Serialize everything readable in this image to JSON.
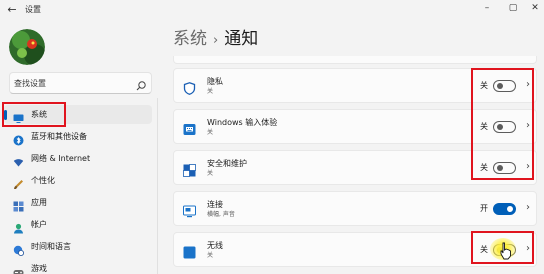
{
  "window": {
    "title": "设置",
    "controls": [
      "minimize-icon",
      "maximize-icon",
      "close-icon"
    ]
  },
  "sidebar": {
    "search": {
      "placeholder": "查找设置",
      "icon": "search-icon"
    },
    "items": [
      {
        "label": "系统",
        "icon": "monitor-icon",
        "active": true
      },
      {
        "label": "蓝牙和其他设备",
        "icon": "bluetooth-icon"
      },
      {
        "label": "网络 & Internet",
        "icon": "wifi-icon"
      },
      {
        "label": "个性化",
        "icon": "brush-icon"
      },
      {
        "label": "应用",
        "icon": "apps-icon"
      },
      {
        "label": "帐户",
        "icon": "person-icon"
      },
      {
        "label": "时间和语言",
        "icon": "globe-clock-icon"
      },
      {
        "label": "游戏",
        "icon": "gamepad-icon"
      }
    ]
  },
  "header": {
    "parent": "系统",
    "separator": "›",
    "current": "通知"
  },
  "cards": [
    {
      "title": "隐私",
      "subtitle": "关",
      "state": "关",
      "on": false,
      "icon": "shield-icon"
    },
    {
      "title": "Windows 输入体验",
      "subtitle": "关",
      "state": "关",
      "on": false,
      "icon": "keyboard-icon"
    },
    {
      "title": "安全和维护",
      "subtitle": "关",
      "state": "关",
      "on": false,
      "icon": "security-flag-icon"
    },
    {
      "title": "连接",
      "subtitle": "横幅, 声音",
      "state": "开",
      "on": true,
      "icon": "connect-icon"
    },
    {
      "title": "无线",
      "subtitle": "关",
      "state": "关",
      "on": false,
      "icon": "wireless-display-icon"
    }
  ],
  "colors": {
    "accent": "#005fb8",
    "annotation": "#e0141e",
    "cursor_highlight": "#fff03c"
  }
}
